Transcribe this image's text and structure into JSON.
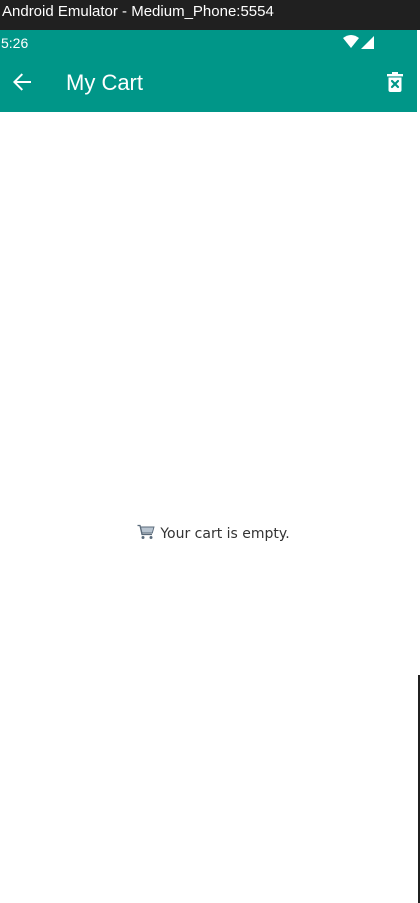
{
  "window": {
    "title": "Android Emulator - Medium_Phone:5554"
  },
  "status_bar": {
    "time": "5:26",
    "icons": [
      "wifi-icon",
      "cell-signal-icon"
    ],
    "color": "#009688"
  },
  "app_bar": {
    "title": "My Cart",
    "back_icon": "arrow-back-icon",
    "action_icon": "delete-cart-icon",
    "color": "#009688"
  },
  "cart": {
    "empty_icon": "shopping-cart-icon",
    "empty_message": "Your cart is empty."
  }
}
